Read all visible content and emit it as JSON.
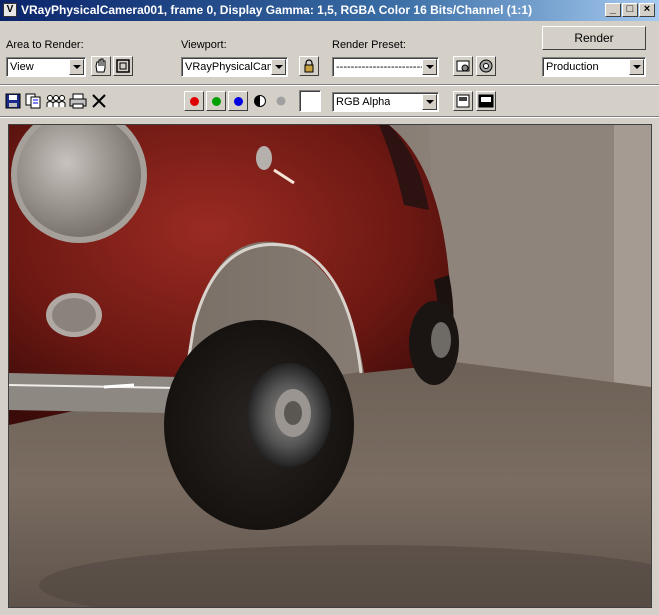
{
  "window": {
    "title": "VRayPhysicalCamera001, frame 0, Display Gamma: 1,5, RGBA Color 16 Bits/Channel (1:1)",
    "app_icon": "V",
    "controls": {
      "minimize": "_",
      "maximize": "□",
      "close": "×"
    }
  },
  "area_to_render": {
    "label": "Area to Render:",
    "value": "View"
  },
  "viewport": {
    "label": "Viewport:",
    "value": "VRayPhysicalCame"
  },
  "render_preset": {
    "label": "Render Preset:",
    "value": "-------------------------"
  },
  "render_button": {
    "label": "Render"
  },
  "production": {
    "value": "Production"
  },
  "channel_display": {
    "value": "RGB Alpha"
  },
  "colors": {
    "red_channel": "#e00000",
    "green_channel": "#00a000",
    "blue_channel": "#0000e0",
    "title_bar": "#0a246a"
  },
  "icons": [
    "save-icon",
    "copy-icon",
    "clone-icon",
    "print-icon",
    "clear-icon",
    "red-channel-icon",
    "green-channel-icon",
    "blue-channel-icon",
    "alpha-channel-icon",
    "mono-icon",
    "swatch-icon",
    "auto-region-icon",
    "crop-icon",
    "lock-icon",
    "environment-icon",
    "render-setup-icon",
    "display-toggle-icon",
    "display-toggle-2-icon"
  ]
}
